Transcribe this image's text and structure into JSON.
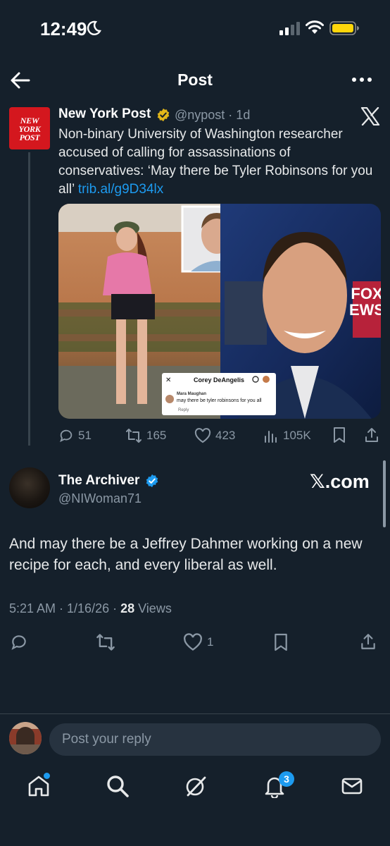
{
  "status_bar": {
    "time": "12:49"
  },
  "header": {
    "title": "Post"
  },
  "quoted_tweet": {
    "logo_text": "NEW YORK POST",
    "name": "New York Post",
    "handle_time": "@nypost · 1d",
    "text": "Non-binary University of Washington researcher accused of calling for assassinations of conservatives: ‘May there be Tyler Robinsons for you all’ ",
    "link": "trib.al/g9D34lx",
    "overlay": {
      "title": "Corey DeAngelis",
      "commenter": "Mara Maughan",
      "comment_time": "· 1h",
      "comment": "may there be tyler robinsons for you all",
      "reply": "Reply",
      "fox_text": "FOX\nNEWS"
    },
    "stats": {
      "replies": "51",
      "reposts": "165",
      "likes": "423",
      "views": "105K"
    }
  },
  "main_tweet": {
    "name": "The Archiver",
    "handle": "@NIWoman71",
    "watermark": "𝕏.com",
    "text": "And may there be a Jeffrey Dahmer working on a new recipe for each, and every liberal as well.",
    "timestamp": "5:21 AM · 1/16/26 · ",
    "views_count": "28",
    "views_label": " Views",
    "likes": "1"
  },
  "reply_bar": {
    "placeholder": "Post your reply"
  },
  "bottom_nav": {
    "notifications_badge": "3"
  },
  "colors": {
    "background": "#15202b",
    "accent": "#1d9bf0",
    "muted": "#8b98a5"
  }
}
